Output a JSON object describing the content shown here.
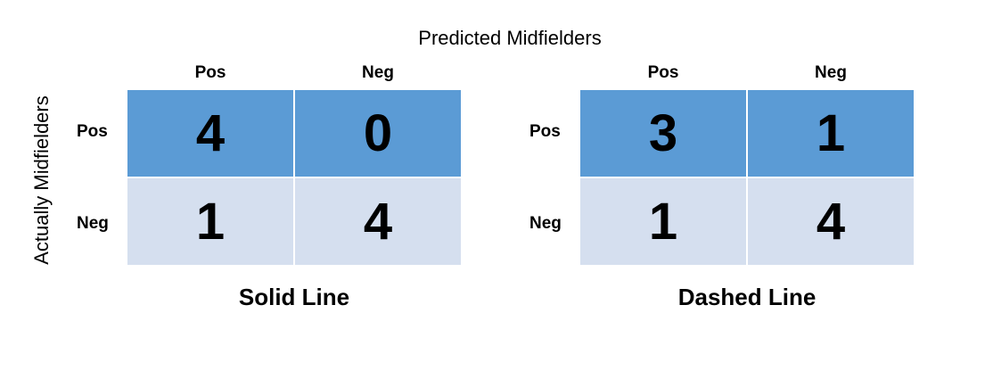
{
  "header": {
    "predicted_label": "Predicted Midfielders",
    "actual_label": "Actually Midfielders"
  },
  "matrices": [
    {
      "caption": "Solid Line",
      "col_labels": [
        "Pos",
        "Neg"
      ],
      "row_labels": [
        "Pos",
        "Neg"
      ],
      "cells": [
        [
          "4",
          "0"
        ],
        [
          "1",
          "4"
        ]
      ]
    },
    {
      "caption": "Dashed Line",
      "col_labels": [
        "Pos",
        "Neg"
      ],
      "row_labels": [
        "Pos",
        "Neg"
      ],
      "cells": [
        [
          "3",
          "1"
        ],
        [
          "1",
          "4"
        ]
      ]
    }
  ],
  "colors": {
    "positive_row": "#5b9bd5",
    "negative_row": "#d5dfef"
  }
}
